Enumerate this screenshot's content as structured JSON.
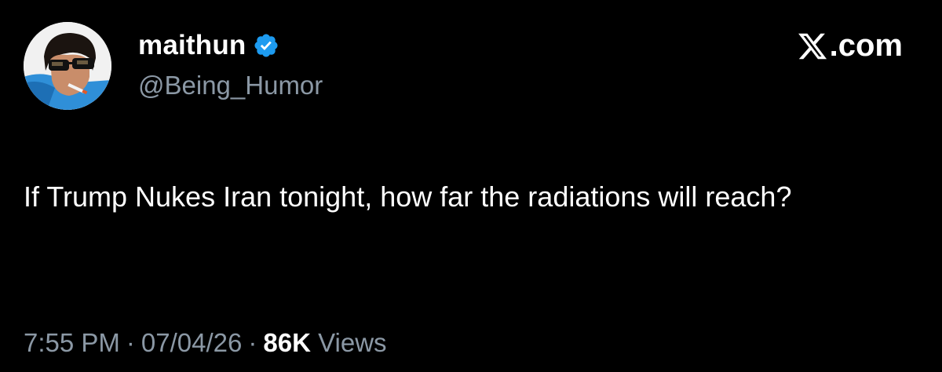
{
  "user": {
    "display_name": "maithun",
    "handle": "@Being_Humor",
    "verified": true,
    "verified_color": "#1d9bf0"
  },
  "brand": {
    "text": ".com",
    "icon": "x-logo-icon"
  },
  "tweet": {
    "text": "If Trump Nukes Iran tonight, how far the radiations will reach?"
  },
  "meta": {
    "time": "7:55 PM",
    "separator": "·",
    "date": "07/04/26",
    "views_count": "86K",
    "views_label": "Views"
  },
  "colors": {
    "background": "#000000",
    "primary_text": "#ffffff",
    "secondary_text": "#8b98a5"
  }
}
